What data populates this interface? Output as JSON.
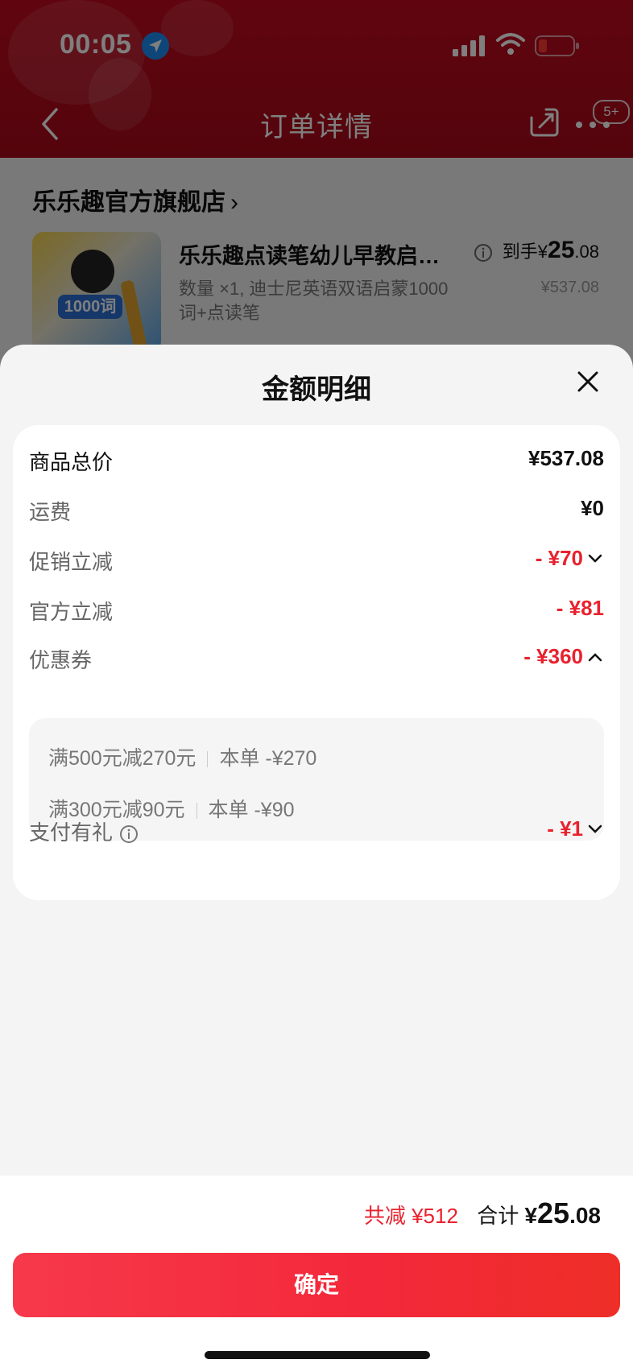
{
  "status_bar": {
    "time": "00:05"
  },
  "nav": {
    "title": "订单详情",
    "more_badge": "5+"
  },
  "order": {
    "store_name": "乐乐趣官方旗舰店",
    "store_chevron": "›",
    "product_title": "乐乐趣点读笔幼儿早教启…",
    "product_spec": "数量 ×1, 迪士尼英语双语启蒙1000词+点读笔",
    "image_label": "1000词",
    "price_prefix": "到手",
    "price_currency": "¥",
    "price_int": "25",
    "price_dec": ".08",
    "price_original": "¥537.08"
  },
  "sheet": {
    "title": "金额明细",
    "rows": [
      {
        "label": "商品总价",
        "value": "¥537.08"
      },
      {
        "label": "运费",
        "value": "¥0"
      },
      {
        "label": "促销立减",
        "value": "- ¥70"
      },
      {
        "label": "官方立减",
        "value": "- ¥81"
      },
      {
        "label": "优惠券",
        "value": "- ¥360"
      },
      {
        "label": "支付有礼",
        "value": "- ¥1"
      }
    ],
    "coupons": [
      {
        "rule": "满500元减270元",
        "applied": "本单 -¥270"
      },
      {
        "rule": "满300元减90元",
        "applied": "本单 -¥90"
      }
    ]
  },
  "footer": {
    "saved_text": "共减 ¥512",
    "total_label": "合计",
    "total_currency": "¥",
    "total_int": "25",
    "total_dec": ".08",
    "confirm_label": "确定"
  },
  "colors": {
    "accent_red": "#e8222e",
    "header_red": "#c10b20",
    "button_red": "#f3283a"
  }
}
